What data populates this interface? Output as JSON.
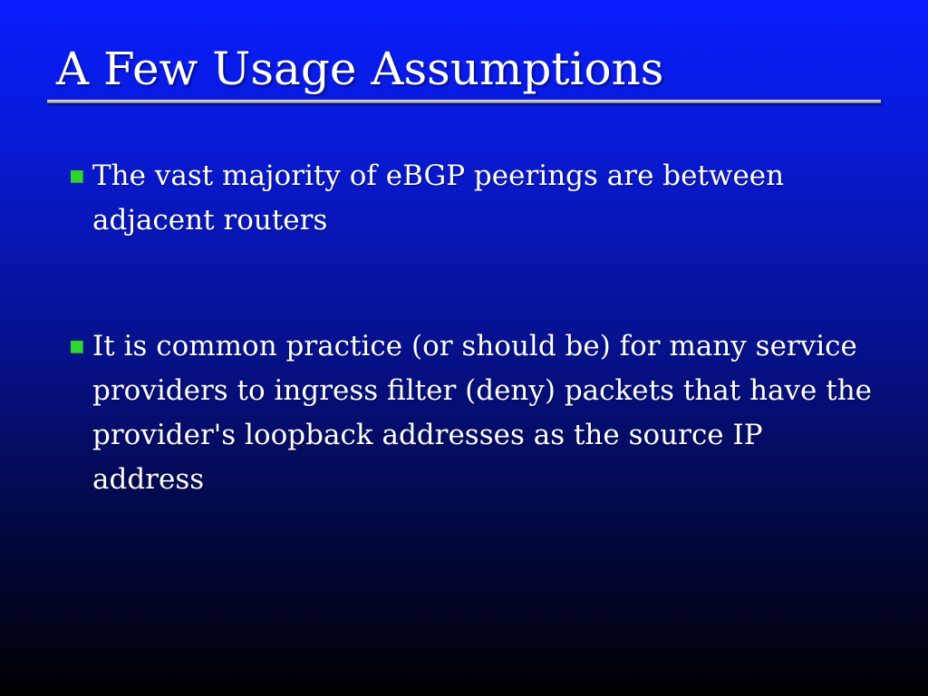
{
  "slide": {
    "title": "A Few Usage Assumptions",
    "bullets": [
      {
        "lines": [
          "The vast majority of eBGP peerings are between",
          "adjacent routers"
        ]
      },
      {
        "lines": [
          "It is common practice (or should be) for many service",
          "providers to ingress filter (deny) packets that have the",
          "provider's loopback addresses as the source IP",
          "address"
        ]
      }
    ]
  },
  "colors": {
    "background_top": "#0a1eff",
    "background_bottom": "#000000",
    "bullet_marker": "#2fd62f",
    "text": "#ffffff"
  }
}
